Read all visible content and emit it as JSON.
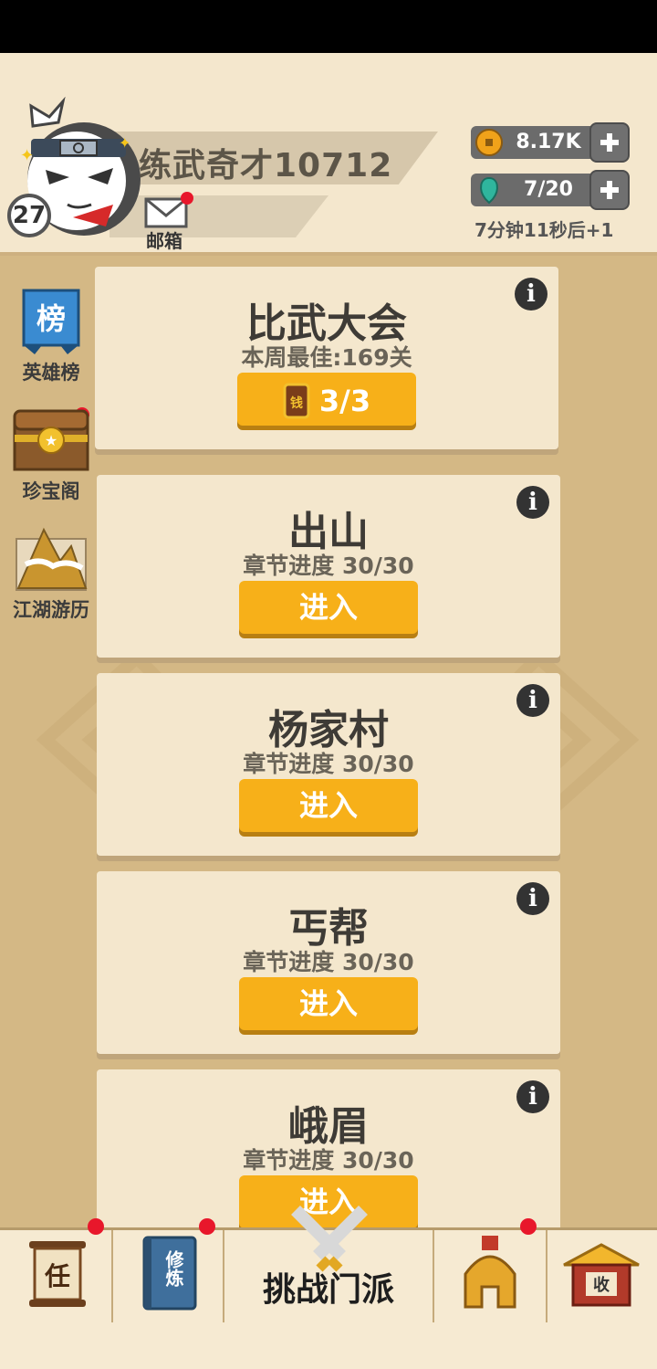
{
  "header": {
    "player_name": "练武奇才10712",
    "level": "27",
    "mail_label": "邮箱",
    "coins": "8.17K",
    "stamina": "7/20",
    "stamina_timer": "7分钟11秒后+1"
  },
  "sidebar": {
    "items": [
      {
        "icon_text": "榜",
        "label": "英雄榜"
      },
      {
        "label": "珍宝阁"
      },
      {
        "label": "江湖游历"
      }
    ]
  },
  "cards": [
    {
      "title": "比武大会",
      "progress": "本周最佳:169关",
      "button_icon_text": "钱",
      "button": "3/3"
    },
    {
      "title": "出山",
      "progress": "章节进度 30/30",
      "button": "进入"
    },
    {
      "title": "杨家村",
      "progress": "章节进度 30/30",
      "button": "进入"
    },
    {
      "title": "丐帮",
      "progress": "章节进度 30/30",
      "button": "进入"
    },
    {
      "title": "峨眉",
      "progress": "章节进度 30/30",
      "button": "进入"
    }
  ],
  "nav": {
    "task_icon_text": "任",
    "cultivate_icon_text": "修炼",
    "challenge_label": "挑战门派",
    "collect_icon_text": "收"
  },
  "colors": {
    "accent_orange": "#f7b019",
    "card_bg": "#f4e7cd",
    "badge_red": "#e8172b"
  }
}
